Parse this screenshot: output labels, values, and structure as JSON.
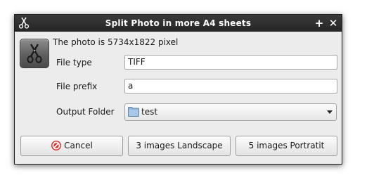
{
  "window": {
    "title": "Split Photo in more A4 sheets",
    "app_icon": "scissors-icon",
    "maximize_glyph": "+",
    "close_glyph": "✕"
  },
  "info": {
    "icon": "scissors-icon",
    "text": "The photo is 5734x1822 pixel"
  },
  "form": {
    "file_type": {
      "label": "File type",
      "value": "TIFF"
    },
    "file_prefix": {
      "label": "File prefix",
      "value": "a"
    },
    "output_folder": {
      "label": "Output Folder",
      "value": "test",
      "icon": "folder-icon"
    }
  },
  "buttons": {
    "cancel": {
      "label": "Cancel",
      "icon": "cancel-icon"
    },
    "landscape": {
      "label": "3 images Landscape"
    },
    "portrait": {
      "label": "5 images Portratit"
    }
  },
  "colors": {
    "titlebar": "#2f2f2f",
    "dialog_bg": "#ececec",
    "folder_icon": "#8fb4dc",
    "cancel_icon": "#d9342b"
  }
}
